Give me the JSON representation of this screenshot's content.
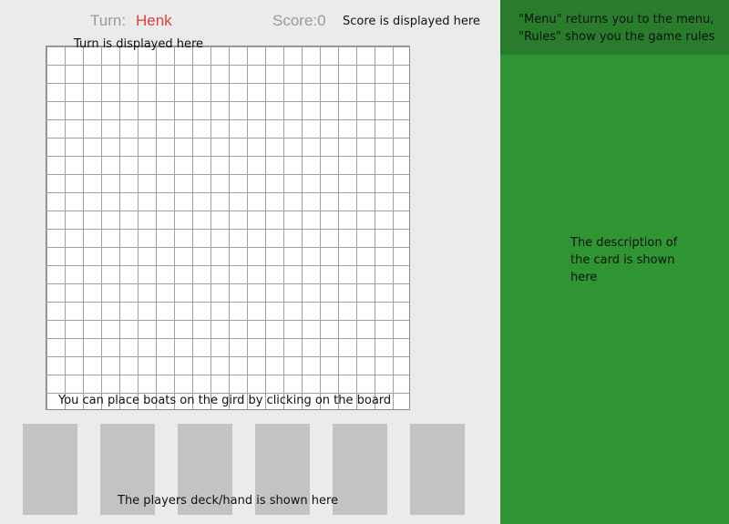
{
  "hud": {
    "turn_label": "Turn:",
    "turn_player": "Henk",
    "score_text": "Score:0"
  },
  "annotations": {
    "score": "Score is displayed here",
    "turn": "Turn is displayed here",
    "board": "You can place boats on the gird by clicking on the board",
    "hand": "The players deck/hand is shown here",
    "menu_line1": "\"Menu\" returns you to the menu,",
    "menu_line2": "\"Rules\" show you the game rules",
    "description_lines": [
      "The description of",
      "the card is shown",
      "here"
    ]
  },
  "board": {
    "columns": 20,
    "rows": 20
  },
  "hand": {
    "card_count": 6
  },
  "colors": {
    "left_background": "#ebebeb",
    "right_background": "#2f9532",
    "menu_bar": "#287c2c",
    "turn_player_text": "#e0403a",
    "card": "#c3c3c3"
  }
}
